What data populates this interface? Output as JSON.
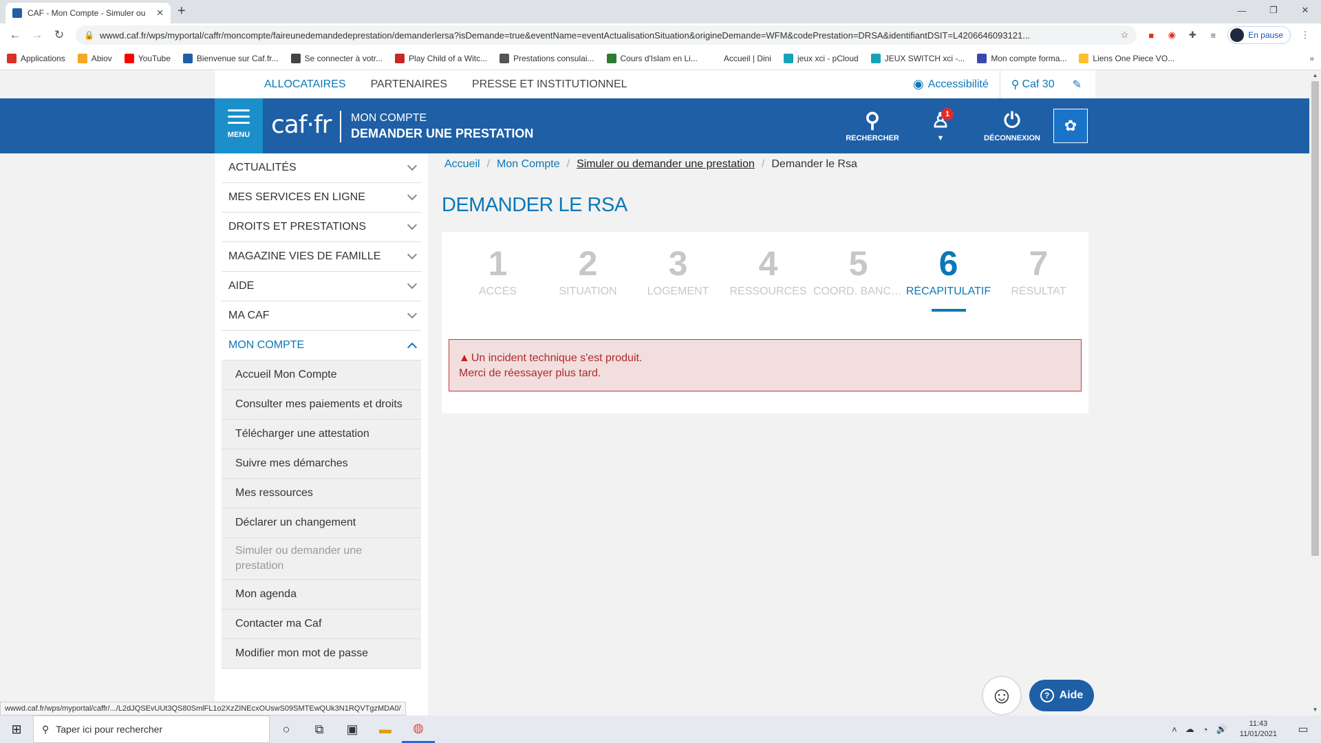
{
  "browser": {
    "tab_title": "CAF - Mon Compte - Simuler ou",
    "tab_close": "✕",
    "new_tab": "+",
    "url": "wwwd.caf.fr/wps/myportal/caffr/moncompte/faireunedemandedeprestation/demanderlersa?isDemande=true&eventName=eventActualisationSituation&origineDemande=WFM&codePrestation=DRSA&identifiantDSIT=L4206646093121...",
    "profile_status": "En pause",
    "bookmarks": [
      {
        "label": "Applications",
        "color": "#d93025"
      },
      {
        "label": "Abiov",
        "color": "#f5a623"
      },
      {
        "label": "YouTube",
        "color": "#ff0000"
      },
      {
        "label": "Bienvenue sur Caf.fr...",
        "color": "#1f5fa6"
      },
      {
        "label": "Se connecter à votr...",
        "color": "#444444"
      },
      {
        "label": "Play Child of a Witc...",
        "color": "#c62828"
      },
      {
        "label": "Prestations consulai...",
        "color": "#555555"
      },
      {
        "label": "Cours d'Islam en Li...",
        "color": "#2e7d32"
      },
      {
        "label": "Accueil | Dini",
        "color": "#ffffff"
      },
      {
        "label": "jeux xci - pCloud",
        "color": "#17a2b8"
      },
      {
        "label": "JEUX SWITCH xci -...",
        "color": "#17a2b8"
      },
      {
        "label": "Mon compte forma...",
        "color": "#3949ab"
      },
      {
        "label": "Liens One Piece VO...",
        "color": "#fbc02d"
      }
    ],
    "status_url": "wwwd.caf.fr/wps/myportal/caffr/.../L2dJQSEvUUt3QS80SmlFL1o2XzZINEcxOUswS09SMTEwQUk3N1RQVTgzMDA0/"
  },
  "topnav": {
    "links": [
      "ALLOCATAIRES",
      "PARTENAIRES",
      "PRESSE ET INSTITUTIONNEL"
    ],
    "accessibility": "Accessibilité",
    "caf_location": "Caf 30"
  },
  "header": {
    "menu_label": "MENU",
    "logo": "caf·fr",
    "title_line1": "MON COMPTE",
    "title_line2": "DEMANDER UNE PRESTATION",
    "search_label": "RECHERCHER",
    "notification_count": "1",
    "logout_label": "DÉCONNEXION"
  },
  "sidebar": {
    "items": [
      "ACTUALITÉS",
      "MES SERVICES EN LIGNE",
      "DROITS ET PRESTATIONS",
      "MAGAZINE VIES DE FAMILLE",
      "AIDE",
      "MA CAF",
      "MON COMPTE"
    ],
    "subitems": [
      "Accueil Mon Compte",
      "Consulter mes paiements et droits",
      "Télécharger une attestation",
      "Suivre mes démarches",
      "Mes ressources",
      "Déclarer un changement",
      "Simuler ou demander une prestation",
      "Mon agenda",
      "Contacter ma Caf",
      "Modifier mon mot de passe"
    ]
  },
  "breadcrumb": [
    "Accueil",
    "Mon Compte",
    "Simuler ou demander une prestation",
    "Demander le Rsa"
  ],
  "page_title": "DEMANDER LE RSA",
  "steps": [
    {
      "num": "1",
      "label": "ACCÈS"
    },
    {
      "num": "2",
      "label": "SITUATION"
    },
    {
      "num": "3",
      "label": "LOGEMENT"
    },
    {
      "num": "4",
      "label": "RESSOURCES"
    },
    {
      "num": "5",
      "label": "COORD. BANCAI..."
    },
    {
      "num": "6",
      "label": "RÉCAPITULATIF"
    },
    {
      "num": "7",
      "label": "RÉSULTAT"
    }
  ],
  "alert": {
    "line1": "Un incident technique s'est produit.",
    "line2": "Merci de réessayer plus tard."
  },
  "aide_label": "Aide",
  "taskbar": {
    "search_placeholder": "Taper ici pour rechercher",
    "time": "11:43",
    "date": "11/01/2021"
  }
}
